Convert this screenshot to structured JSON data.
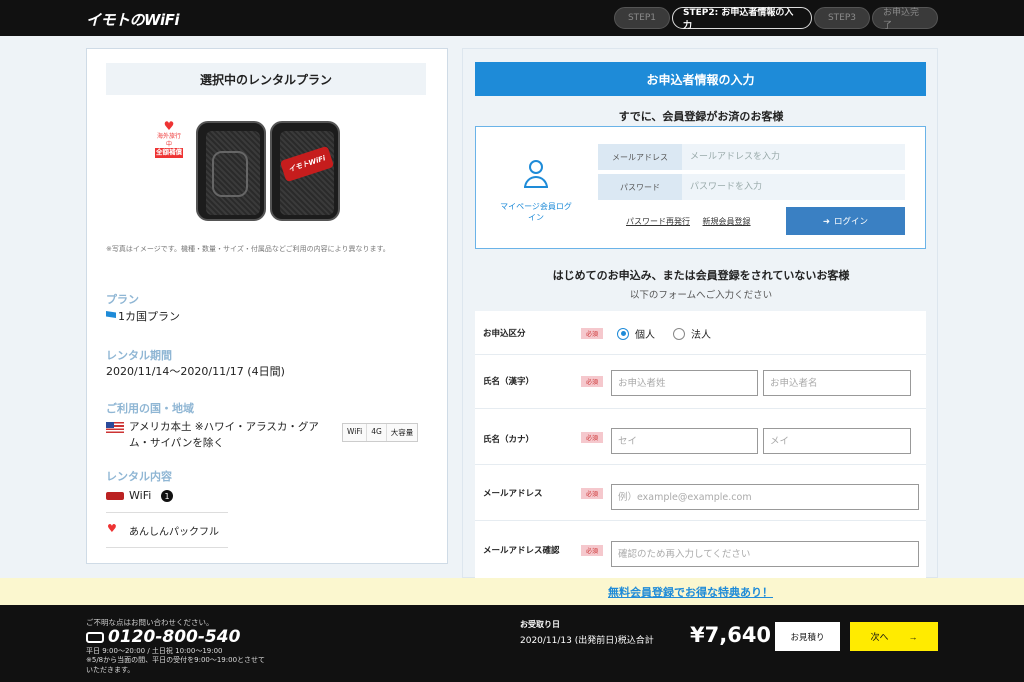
{
  "header": {
    "logo": "イモトのWiFi",
    "steps": [
      {
        "label": "STEP1"
      },
      {
        "label": "STEP2: お申込者情報の入力"
      },
      {
        "label": "STEP3"
      },
      {
        "label": "お申込完了"
      }
    ]
  },
  "plan": {
    "heading": "選択中のレンタルプラン",
    "badge_top": "海外旅行中",
    "badge_main": "全額補償",
    "device_logo": "イモトWiFi",
    "note": "※写真はイメージです。機種・数量・サイズ・付属品などご利用の内容により異なります。",
    "plan_label": "プラン",
    "plan_value": "1カ国プラン",
    "period_label": "レンタル期間",
    "period_value": "2020/11/14〜2020/11/17 (4日間)",
    "country_label": "ご利用の国・地域",
    "country_value": "アメリカ本土 ※ハワイ・アラスカ・グアム・サイパンを除く",
    "tags": [
      "WiFi",
      "4G",
      "大容量"
    ],
    "content_label": "レンタル内容",
    "wifi_item": "WiFi",
    "wifi_count": "1",
    "anshin": "あんしんパックフル"
  },
  "form": {
    "heading": "お申込者情報の入力",
    "member_title": "すでに、会員登録がお済のお客様",
    "mypage_login": "マイページ会員ログイン",
    "email_label": "メールアドレス",
    "email_placeholder": "メールアドレスを入力",
    "password_label": "パスワード",
    "password_placeholder": "パスワードを入力",
    "reissue_link": "パスワード再発行",
    "register_link": "新規会員登録",
    "login_button": "ログイン",
    "new_title": "はじめてのお申込み、または会員登録をされていないお客様",
    "new_sub": "以下のフォームへご入力ください",
    "required": "必須",
    "rows": {
      "type": {
        "label": "お申込区分",
        "option1": "個人",
        "option2": "法人"
      },
      "name": {
        "label": "氏名（漢字）",
        "ph_last": "お申込者姓",
        "ph_first": "お申込者名"
      },
      "kana": {
        "label": "氏名（カナ）",
        "ph_last": "セイ",
        "ph_first": "メイ"
      },
      "mail": {
        "label": "メールアドレス",
        "ph": "例）example@example.com"
      },
      "mail2": {
        "label": "メールアドレス確認",
        "ph": "確認のため再入力してください"
      }
    }
  },
  "banner": {
    "text": "無料会員登録でお得な特典あり！"
  },
  "footer": {
    "ask": "ご不明な点はお問い合わせください。",
    "tel": "0120-800-540",
    "hours1": "平日 9:00〜20:00 / 土日祝 10:00〜19:00",
    "hours2": "※5/8から当面の間、平日の受付を9:00〜19:00とさせていただきます。",
    "receive_label": "お受取り日",
    "receive_date": "2020/11/13 (出発前日)税込合計",
    "total": "¥7,640",
    "quote_button": "お見積り",
    "next_button": "次へ",
    "next_arrow": "→"
  }
}
